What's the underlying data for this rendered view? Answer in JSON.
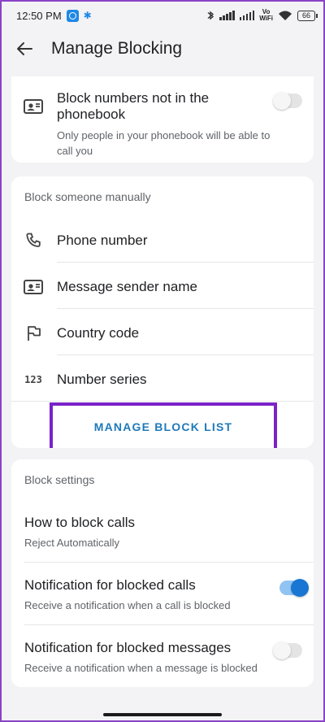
{
  "status_bar": {
    "time": "12:50 PM",
    "vowifi_top": "Vo",
    "vowifi_bottom": "WiFi",
    "battery": "66"
  },
  "app_bar": {
    "title": "Manage Blocking"
  },
  "phonebook_card": {
    "title": "Block numbers not in the phonebook",
    "subtitle": "Only people in your phonebook will be able to call you",
    "toggle_on": false
  },
  "manual_card": {
    "header": "Block someone manually",
    "items": [
      {
        "label": "Phone number",
        "icon": "phone-icon"
      },
      {
        "label": "Message sender name",
        "icon": "contact-card-icon"
      },
      {
        "label": "Country code",
        "icon": "flag-icon"
      },
      {
        "label": "Number series",
        "icon": "number-series-icon"
      }
    ],
    "manage_button": "MANAGE BLOCK LIST"
  },
  "settings_card": {
    "header": "Block settings",
    "items": [
      {
        "title": "How to block calls",
        "subtitle": "Reject Automatically"
      },
      {
        "title": "Notification for blocked calls",
        "subtitle": "Receive a notification when a call is blocked",
        "toggle_on": true
      },
      {
        "title": "Notification for blocked messages",
        "subtitle": "Receive a notification when a message is blocked",
        "toggle_on": false
      }
    ]
  },
  "colors": {
    "accent": "#1976d2",
    "highlight_border": "#7b22c8",
    "button_text": "#1f7ab8"
  }
}
